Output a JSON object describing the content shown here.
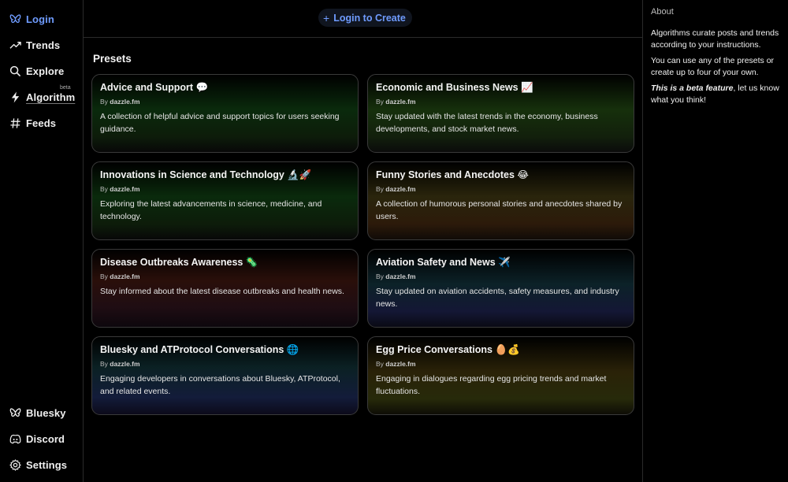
{
  "sidebar": {
    "top_items": [
      {
        "label": "Login",
        "icon": "butterfly-icon",
        "active": true
      },
      {
        "label": "Trends",
        "icon": "trending-icon"
      },
      {
        "label": "Explore",
        "icon": "search-icon"
      },
      {
        "label": "Algorithm",
        "icon": "lightning-icon",
        "badge": "beta"
      },
      {
        "label": "Feeds",
        "icon": "hash-icon"
      }
    ],
    "bottom_items": [
      {
        "label": "Bluesky",
        "icon": "butterfly-icon"
      },
      {
        "label": "Discord",
        "icon": "discord-icon"
      },
      {
        "label": "Settings",
        "icon": "gear-icon"
      }
    ]
  },
  "topbar": {
    "login_create": "Login to Create"
  },
  "presets": {
    "title": "Presets",
    "cards": [
      {
        "title": "Advice and Support 💬",
        "by": "By",
        "author": "dazzle.fm",
        "description": "A collection of helpful advice and support topics for users seeking guidance."
      },
      {
        "title": "Economic and Business News 📈",
        "by": "By",
        "author": "dazzle.fm",
        "description": "Stay updated with the latest trends in the economy, business developments, and stock market news."
      },
      {
        "title": "Innovations in Science and Technology 🔬🚀",
        "by": "By",
        "author": "dazzle.fm",
        "description": "Exploring the latest advancements in science, medicine, and technology."
      },
      {
        "title": "Funny Stories and Anecdotes 😂",
        "by": "By",
        "author": "dazzle.fm",
        "description": "A collection of humorous personal stories and anecdotes shared by users."
      },
      {
        "title": "Disease Outbreaks Awareness 🦠",
        "by": "By",
        "author": "dazzle.fm",
        "description": "Stay informed about the latest disease outbreaks and health news."
      },
      {
        "title": "Aviation Safety and News ✈️",
        "by": "By",
        "author": "dazzle.fm",
        "description": "Stay updated on aviation accidents, safety measures, and industry news."
      },
      {
        "title": "Bluesky and ATProtocol Conversations 🌐",
        "by": "By",
        "author": "dazzle.fm",
        "description": "Engaging developers in conversations about Bluesky, ATProtocol, and related events."
      },
      {
        "title": "Egg Price Conversations 🥚💰",
        "by": "By",
        "author": "dazzle.fm",
        "description": "Engaging in dialogues regarding egg pricing trends and market fluctuations."
      }
    ]
  },
  "about": {
    "heading": "About",
    "p1": "Algorithms curate posts and trends according to your instructions.",
    "p2": "You can use any of the presets or create up to four of your own.",
    "p3_emphasis": "This is a beta feature",
    "p3_rest": ", let us know what you think!"
  },
  "colors": {
    "accent": "#6f9cff",
    "background": "#000000",
    "border": "#2a2a2a"
  }
}
